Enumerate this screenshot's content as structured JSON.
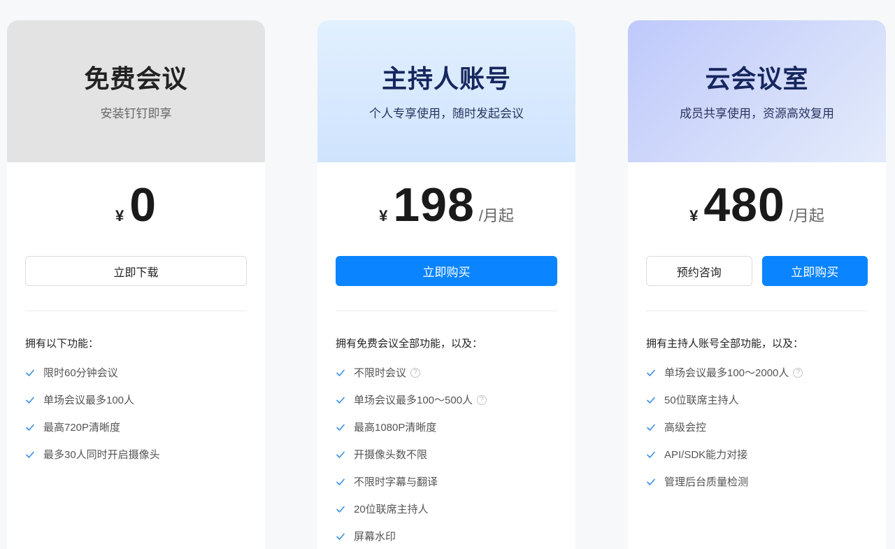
{
  "colors": {
    "accent": "#0a84ff",
    "check": "#3a8ee6"
  },
  "plans": [
    {
      "name": "免费会议",
      "subtitle": "安装钉钉即享",
      "currency": "¥",
      "amount": "0",
      "unit": "",
      "buttons": {
        "outline": "立即下载",
        "primary": ""
      },
      "features_title": "拥有以下功能：",
      "features": [
        "限时60分钟会议",
        "单场会议最多100人",
        "最高720P清晰度",
        "最多30人同时开启摄像头"
      ]
    },
    {
      "name": "主持人账号",
      "subtitle": "个人专享使用，随时发起会议",
      "currency": "¥",
      "amount": "198",
      "unit": "/月起",
      "buttons": {
        "outline": "",
        "primary": "立即购买"
      },
      "features_title": "拥有免费会议全部功能，以及：",
      "features": [
        "不限时会议",
        "单场会议最多100～500人",
        "最高1080P清晰度",
        "开摄像头数不限",
        "不限时字幕与翻译",
        "20位联席主持人",
        "屏幕水印"
      ]
    },
    {
      "name": "云会议室",
      "subtitle": "成员共享使用，资源高效复用",
      "currency": "¥",
      "amount": "480",
      "unit": "/月起",
      "buttons": {
        "outline": "预约咨询",
        "primary": "立即购买"
      },
      "features_title": "拥有主持人账号全部功能，以及：",
      "features": [
        "单场会议最多100～2000人",
        "50位联席主持人",
        "高级会控",
        "API/SDK能力对接",
        "管理后台质量检测"
      ]
    }
  ],
  "help_glyph": "?"
}
